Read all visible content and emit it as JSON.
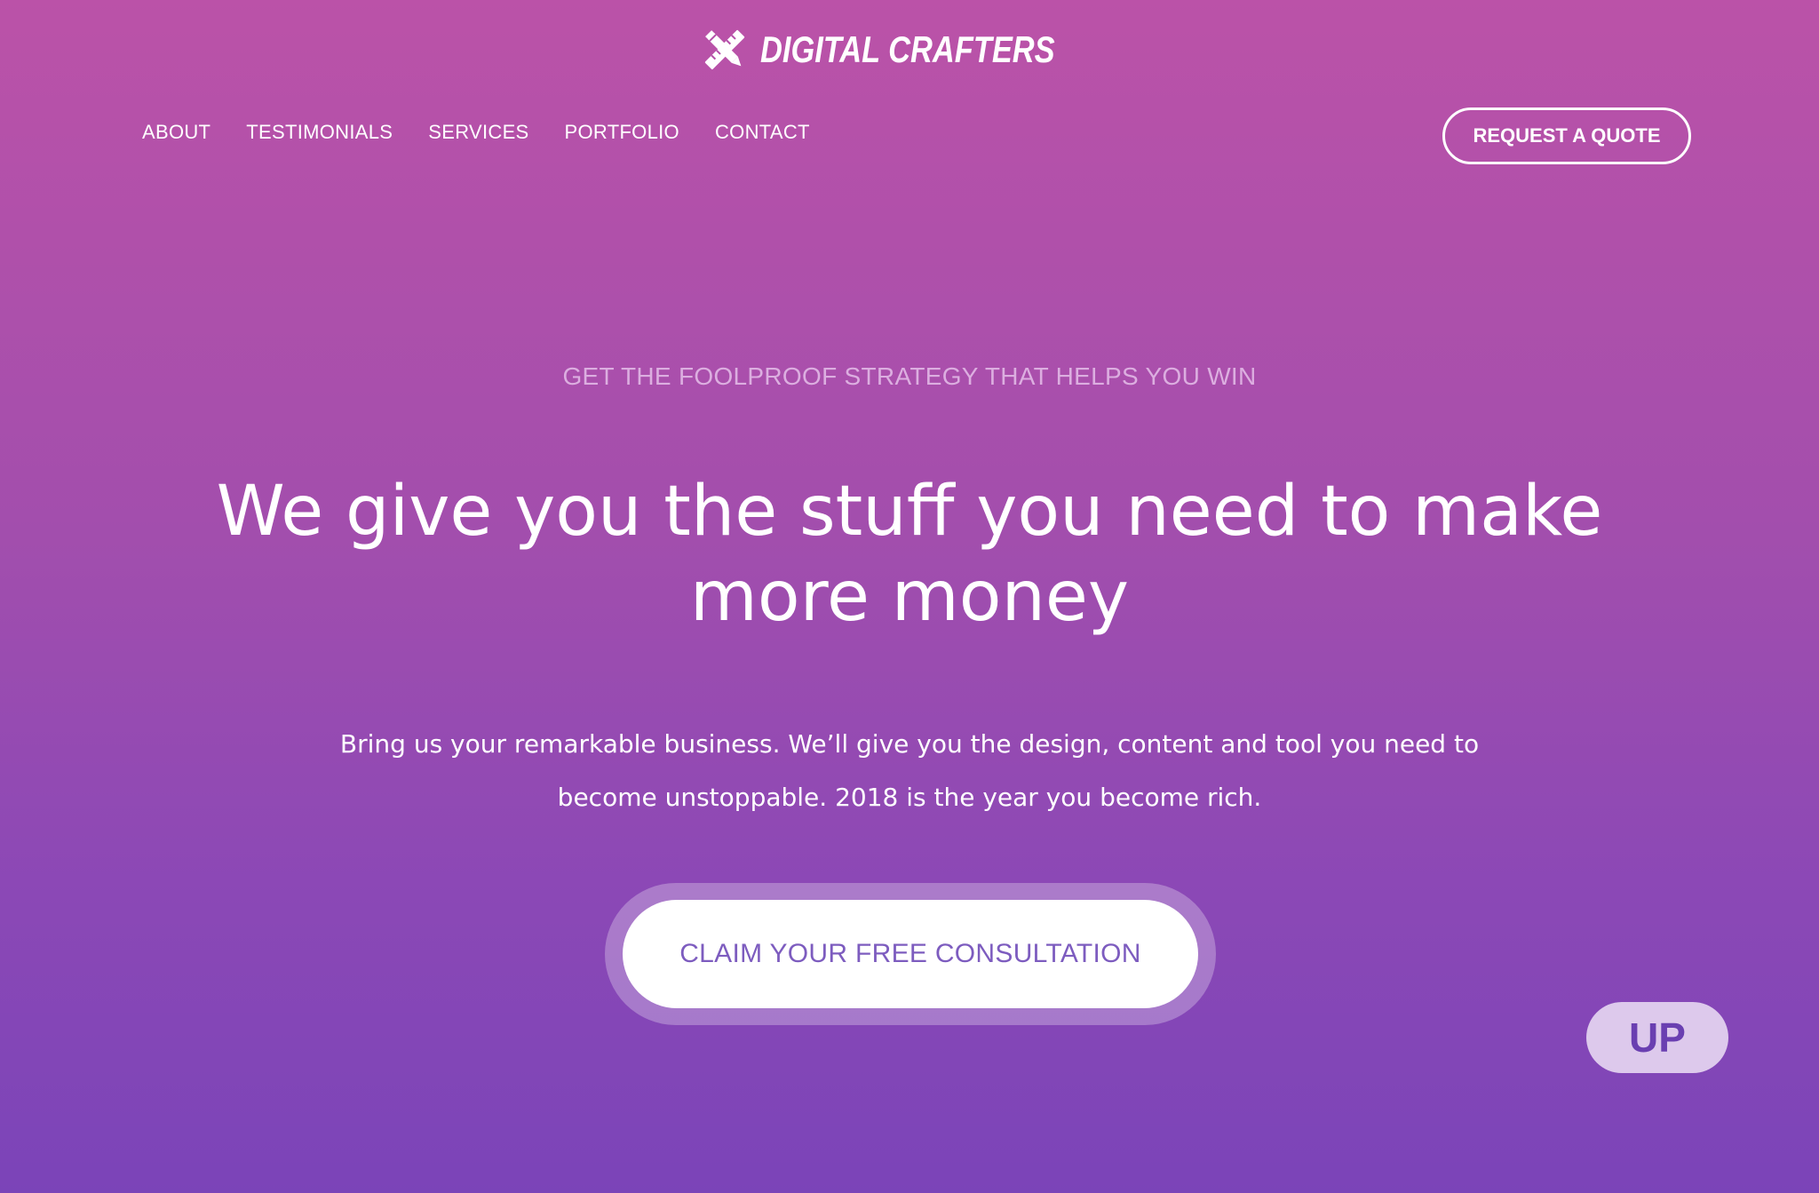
{
  "brand": {
    "name": "DIGITAL CRAFTERS",
    "icon": "pencil-ruler-crossed-icon"
  },
  "nav": {
    "items": [
      {
        "label": "ABOUT"
      },
      {
        "label": "TESTIMONIALS"
      },
      {
        "label": "SERVICES"
      },
      {
        "label": "PORTFOLIO"
      },
      {
        "label": "CONTACT"
      }
    ],
    "quote_button": "REQUEST A QUOTE"
  },
  "hero": {
    "eyebrow": "GET THE FOOLPROOF STRATEGY THAT HELPS YOU WIN",
    "headline_line1": "We give you the stuff you need to make",
    "headline_line2": "more money",
    "lede_line1": "Bring us your remarkable business. We’ll give you the design, content and tool you need to",
    "lede_line2": "become unstoppable. 2018 is the year you become rich.",
    "cta": "CLAIM YOUR FREE CONSULTATION"
  },
  "scroll_top": {
    "label": "UP"
  },
  "colors": {
    "gradient_top": "#bb52a8",
    "gradient_bottom": "#7b44b8",
    "cta_text": "#7d5cbf",
    "up_bg": "#ddc9ec",
    "up_text": "#6a3fb1",
    "eyebrow_text": "#dcaee0"
  }
}
